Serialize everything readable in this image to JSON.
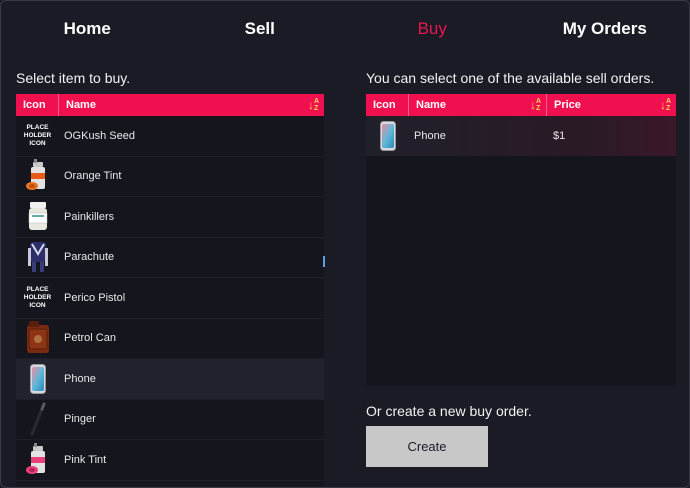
{
  "nav": {
    "tabs": [
      {
        "label": "Home"
      },
      {
        "label": "Sell"
      },
      {
        "label": "Buy",
        "active": true
      },
      {
        "label": "My Orders"
      }
    ]
  },
  "left": {
    "title": "Select item to buy.",
    "columns": {
      "icon": "Icon",
      "name": "Name"
    },
    "items": [
      {
        "name": "OGKush Seed",
        "icon": "placeholder-icon",
        "placeholder": [
          "PLACE",
          "HOLDER",
          "ICON"
        ]
      },
      {
        "name": "Orange Tint",
        "icon": "spray-can-orange-icon"
      },
      {
        "name": "Painkillers",
        "icon": "pill-bottle-icon"
      },
      {
        "name": "Parachute",
        "icon": "parachute-icon"
      },
      {
        "name": "Perico Pistol",
        "icon": "placeholder-icon",
        "placeholder": [
          "PLACE",
          "HOLDER",
          "ICON"
        ]
      },
      {
        "name": "Petrol Can",
        "icon": "jerry-can-icon"
      },
      {
        "name": "Phone",
        "icon": "phone-icon",
        "selected": true
      },
      {
        "name": "Pinger",
        "icon": "pinger-icon"
      },
      {
        "name": "Pink Tint",
        "icon": "spray-can-pink-icon"
      }
    ]
  },
  "right": {
    "title": "You can select one of the available sell orders.",
    "columns": {
      "icon": "Icon",
      "name": "Name",
      "price": "Price"
    },
    "orders": [
      {
        "name": "Phone",
        "price": "$1",
        "icon": "phone-icon"
      }
    ]
  },
  "create": {
    "title": "Or create a new buy order.",
    "button_label": "Create"
  },
  "colors": {
    "accent": "#e8154f",
    "header": "#f0104f",
    "background": "#1b1b25",
    "button": "#c8c8c8"
  }
}
